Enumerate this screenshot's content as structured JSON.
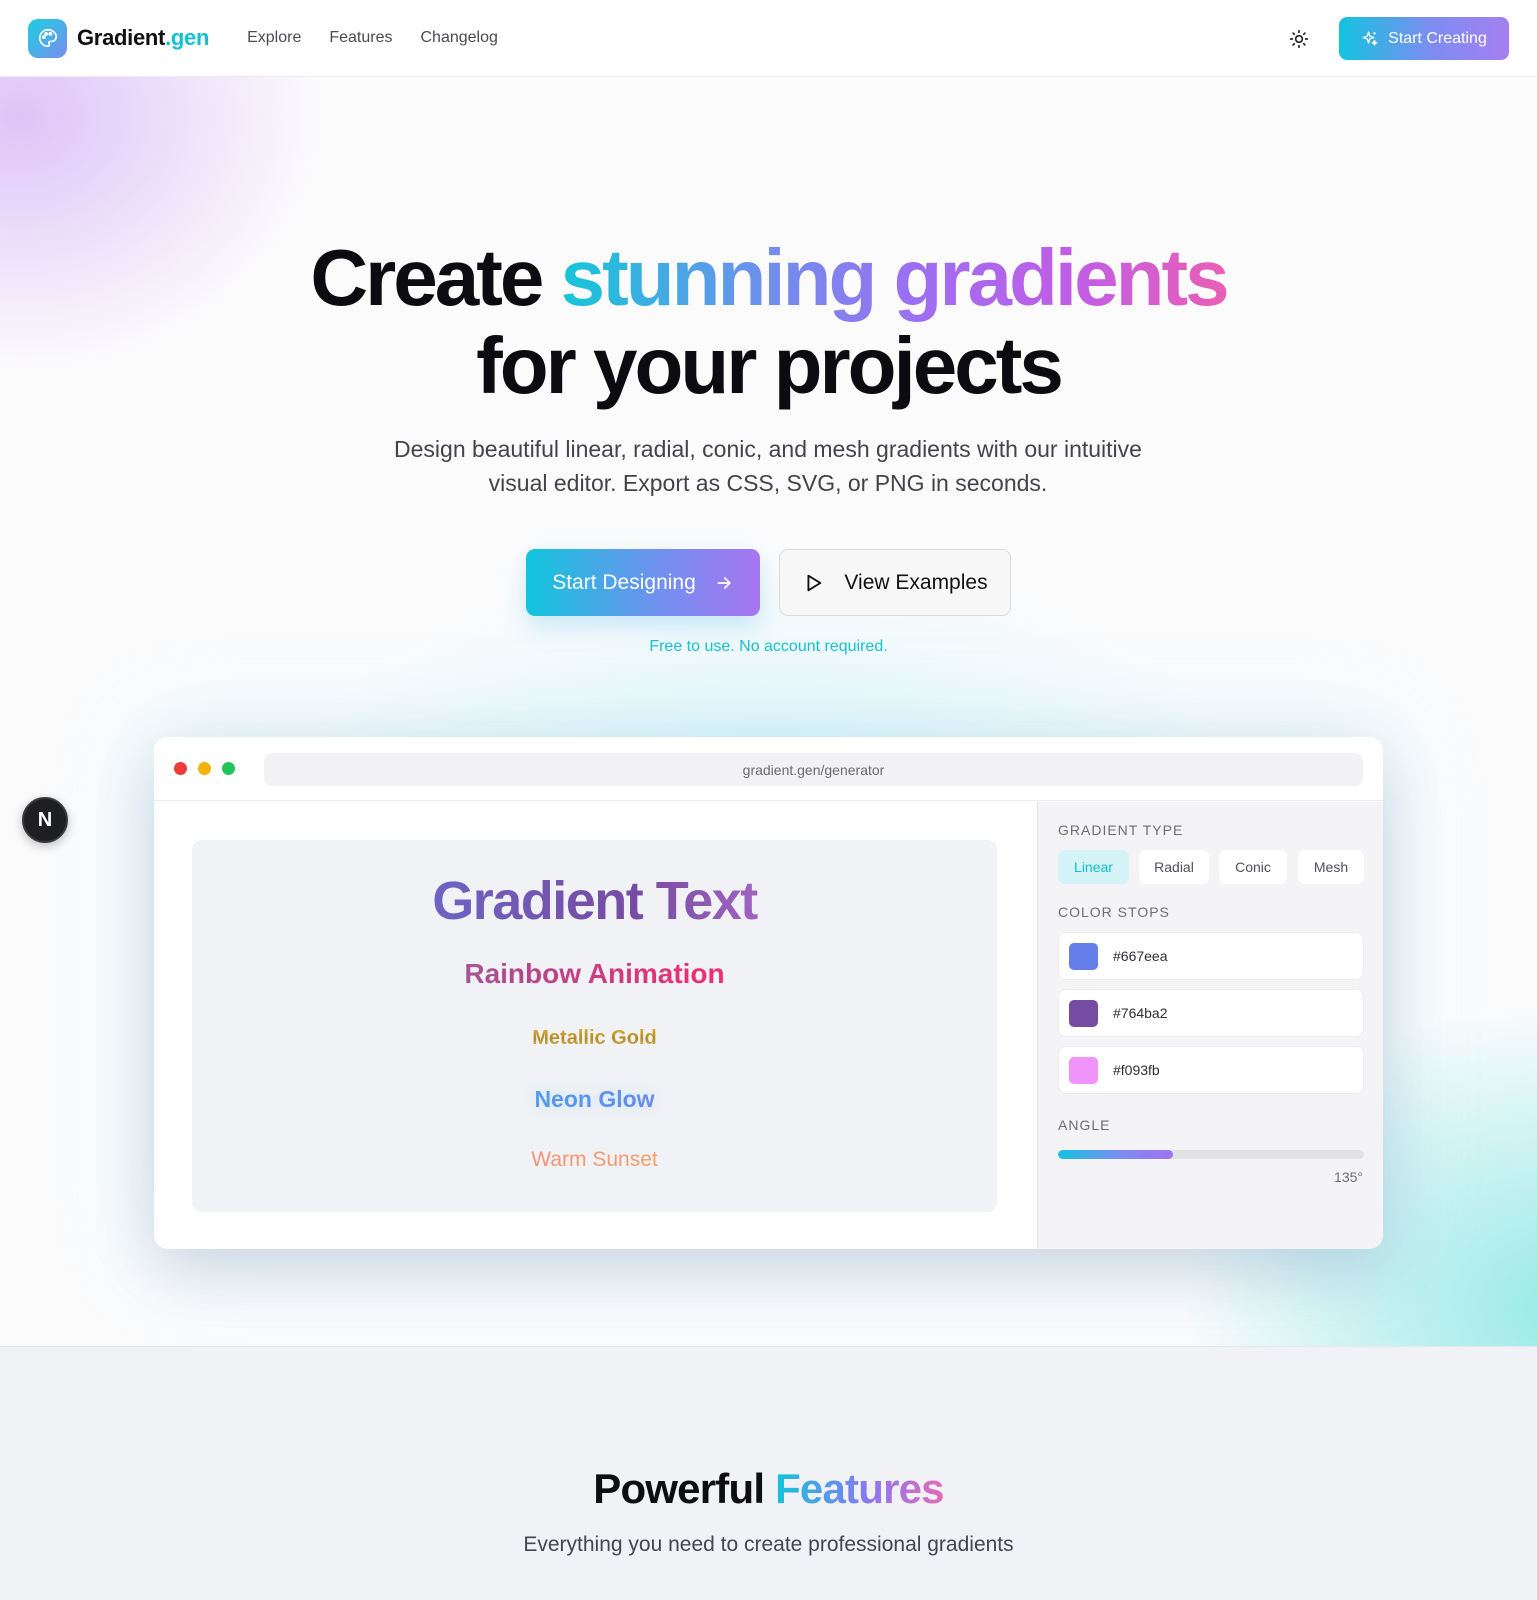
{
  "nav": {
    "brand_main": "Gradient",
    "brand_tld": ".gen",
    "links": [
      "Explore",
      "Features",
      "Changelog"
    ],
    "theme_icon": "sun-icon",
    "cta_label": "Start Creating"
  },
  "hero": {
    "title_plain_1": "Create ",
    "title_grad_1": "stunning gradients",
    "title_line_2": "for your projects",
    "subtitle": "Design beautiful linear, radial, conic, and mesh gradients with our intuitive visual editor. Export as CSS, SVG, or PNG in seconds.",
    "primary_label": "Start Designing",
    "secondary_label": "View Examples",
    "note": "Free to use. No account required."
  },
  "floating_button": {
    "label": "N"
  },
  "mock_window": {
    "url": "gradient.gen/generator",
    "previews": [
      "Gradient Text",
      "Rainbow Animation",
      "Metallic Gold",
      "Neon Glow",
      "Warm Sunset"
    ],
    "panel": {
      "gradient_type_label": "GRADIENT TYPE",
      "types": [
        "Linear",
        "Radial",
        "Conic",
        "Mesh"
      ],
      "active_type": "Linear",
      "color_stops_label": "COLOR STOPS",
      "stops": [
        {
          "hex": "#667eea",
          "color": "#667eea"
        },
        {
          "hex": "#764ba2",
          "color": "#764ba2"
        },
        {
          "hex": "#f093fb",
          "color": "#f093fb"
        }
      ],
      "angle_label": "ANGLE",
      "angle_value": "135°",
      "angle_fraction": 0.375
    }
  },
  "features": {
    "title_plain": "Powerful ",
    "title_grad": "Features",
    "subtitle": "Everything you need to create professional gradients"
  },
  "colors": {
    "accent_cyan": "#13c3de",
    "accent_purple": "#a173ef",
    "accent_pink": "#ea5fb4"
  }
}
